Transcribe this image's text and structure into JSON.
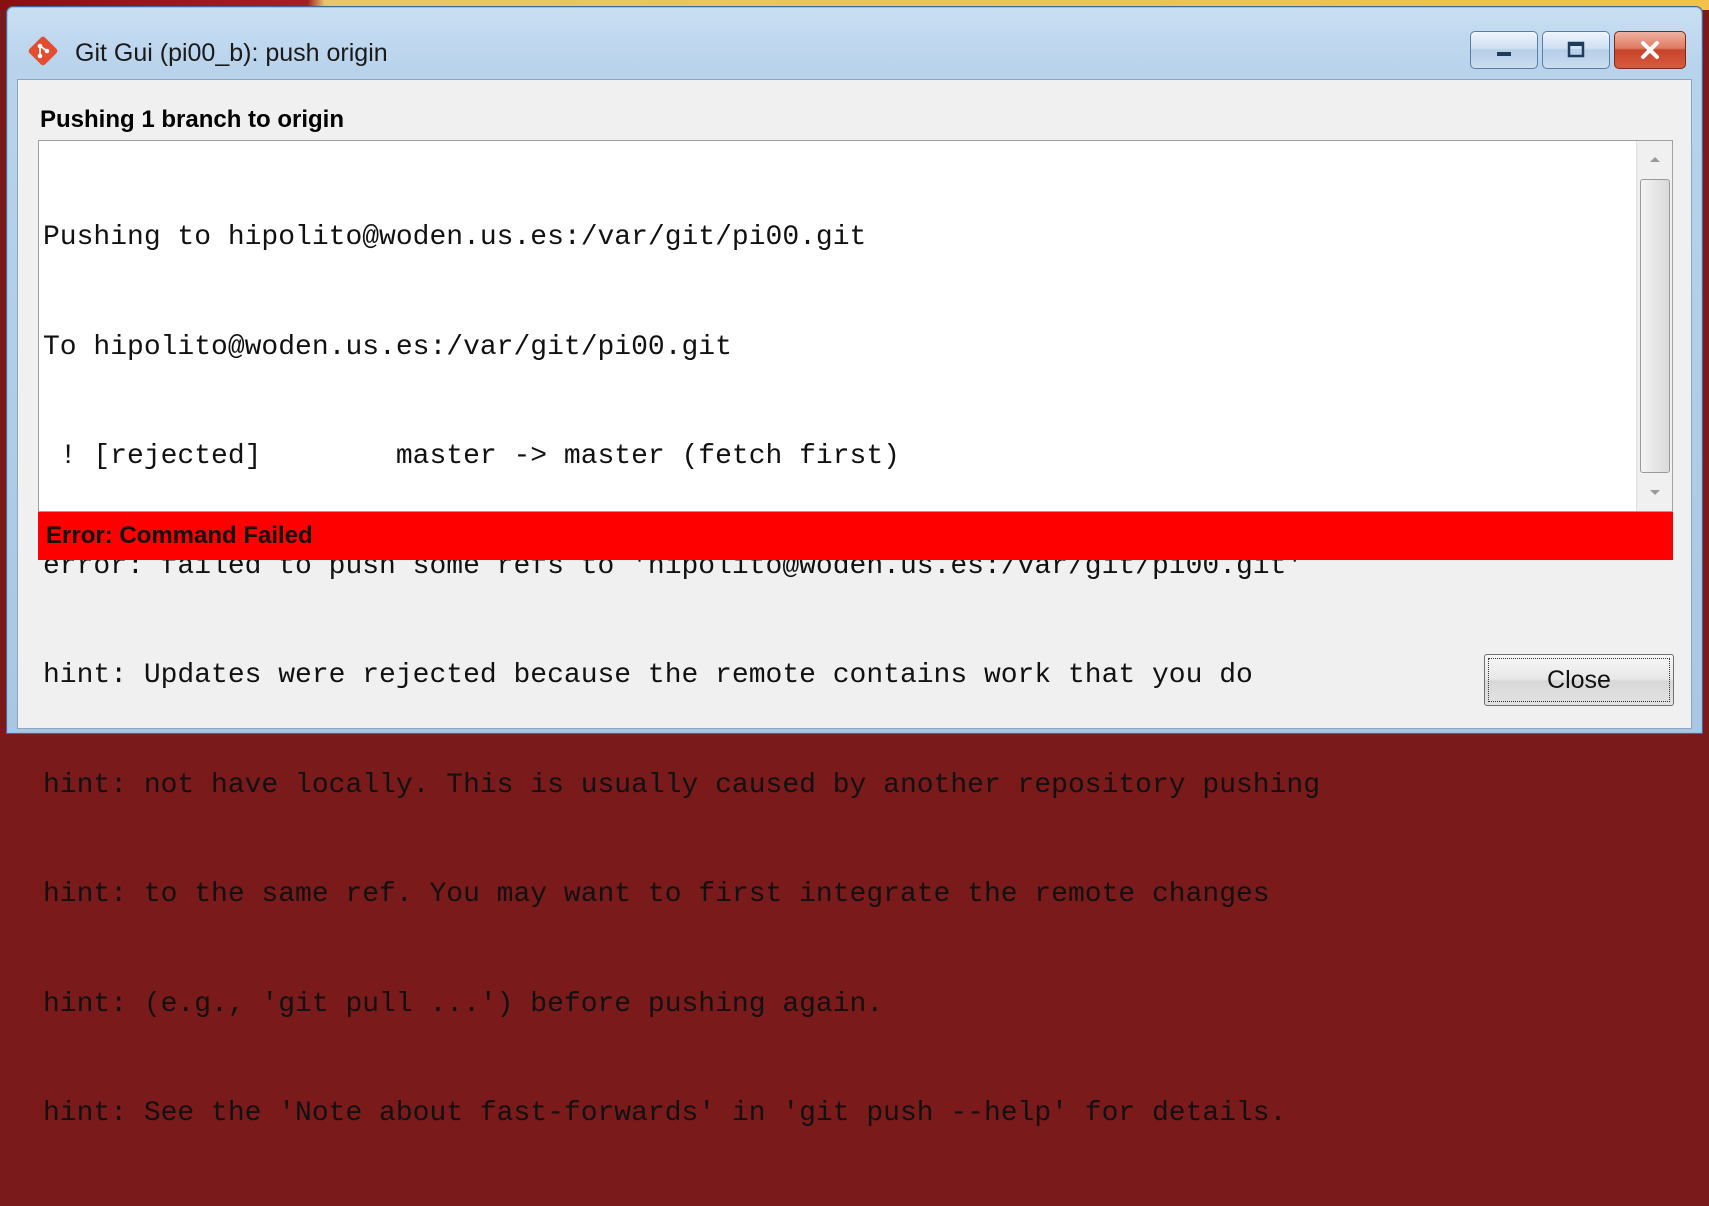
{
  "window": {
    "title": "Git Gui (pi00_b): push origin",
    "icon": "git-diamond-icon",
    "accent": "#e44c30"
  },
  "dialog": {
    "heading": "Pushing 1 branch to origin",
    "log_lines": [
      "Pushing to hipolito@woden.us.es:/var/git/pi00.git",
      "To hipolito@woden.us.es:/var/git/pi00.git",
      " ! [rejected]        master -> master (fetch first)",
      "error: failed to push some refs to 'hipolito@woden.us.es:/var/git/pi00.git'",
      "hint: Updates were rejected because the remote contains work that you do",
      "hint: not have locally. This is usually caused by another repository pushing",
      "hint: to the same ref. You may want to first integrate the remote changes",
      "hint: (e.g., 'git pull ...') before pushing again.",
      "hint: See the 'Note about fast-forwards' in 'git push --help' for details."
    ],
    "status": "Error: Command Failed",
    "status_color": "#ff0000",
    "close_label": "Close"
  }
}
